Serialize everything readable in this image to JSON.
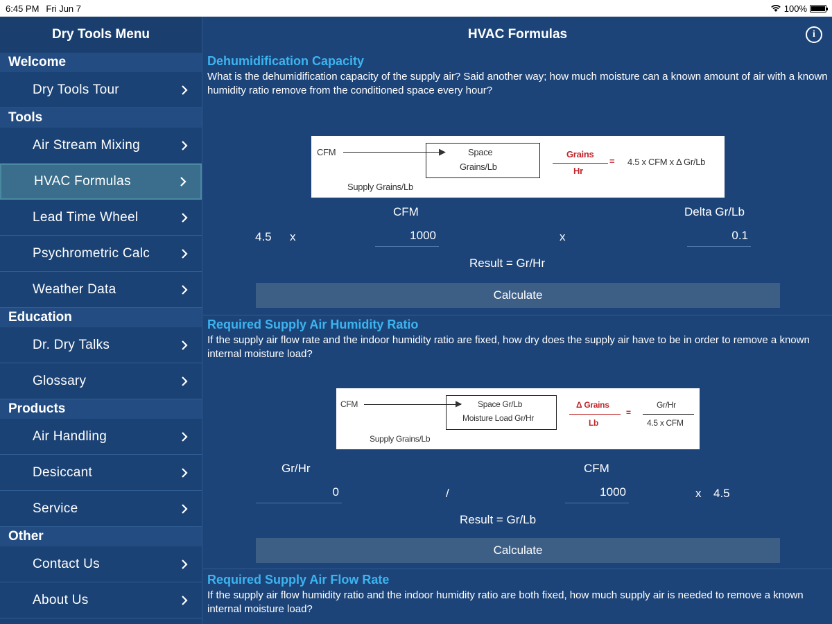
{
  "status": {
    "time": "6:45 PM",
    "date": "Fri Jun 7",
    "battery": "100%"
  },
  "sidebar": {
    "title": "Dry Tools Menu",
    "sections": [
      {
        "title": "Welcome",
        "items": [
          "Dry Tools Tour"
        ]
      },
      {
        "title": "Tools",
        "items": [
          "Air Stream Mixing",
          "HVAC Formulas",
          "Lead Time Wheel",
          "Psychrometric Calc",
          "Weather Data"
        ]
      },
      {
        "title": "Education",
        "items": [
          "Dr. Dry Talks",
          "Glossary"
        ]
      },
      {
        "title": "Products",
        "items": [
          "Air Handling",
          "Desiccant",
          "Service"
        ]
      },
      {
        "title": "Other",
        "items": [
          "Contact Us",
          "About Us"
        ]
      }
    ],
    "selected": "HVAC Formulas"
  },
  "main": {
    "title": "HVAC Formulas",
    "s1": {
      "title": "Dehumidification Capacity",
      "desc": "What is the dehumidification capacity of the supply air? Said another way; how much moisture can a known amount of air with a known humidity ratio remove from the conditioned space every hour?",
      "diagram": {
        "cfm": "CFM",
        "space": "Space",
        "grains_lb": "Grains/Lb",
        "supply": "Supply Grains/Lb",
        "num": "Grains",
        "den": "Hr",
        "eq": "=",
        "rhs": "4.5 x CFM x Δ Gr/Lb"
      },
      "cfm_label": "CFM",
      "delta_label": "Delta Gr/Lb",
      "const": "4.5",
      "x1": "x",
      "cfm_value": "1000",
      "x2": "x",
      "delta_value": "0.1",
      "result": "Result = Gr/Hr",
      "button": "Calculate"
    },
    "s2": {
      "title": "Required Supply Air Humidity Ratio",
      "desc": "If the supply air flow rate and the indoor humidity ratio are fixed, how dry does the supply air have to be in order to remove a known internal moisture load?",
      "diagram": {
        "cfm": "CFM",
        "space": "Space Gr/Lb",
        "moisture": "Moisture Load Gr/Hr",
        "supply": "Supply Grains/Lb",
        "num": "Δ Grains",
        "den": "Lb",
        "eq": "=",
        "rnum": "Gr/Hr",
        "rden": "4.5 x CFM"
      },
      "grhr_label": "Gr/Hr",
      "cfm_label": "CFM",
      "grhr_value": "0",
      "slash": "/",
      "cfm_value": "1000",
      "x": "x",
      "const": "4.5",
      "result": "Result  = Gr/Lb",
      "button": "Calculate"
    },
    "s3": {
      "title": "Required Supply Air Flow Rate",
      "desc": "If the supply air flow humidity ratio and the indoor humidity ratio are both fixed, how much supply air is needed to remove a known internal moisture load?"
    }
  }
}
